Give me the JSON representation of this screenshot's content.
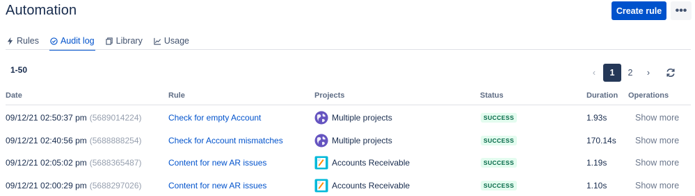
{
  "header": {
    "title": "Automation",
    "create_label": "Create rule",
    "more_label": "•••"
  },
  "tabs": [
    {
      "label": "Rules",
      "icon": "bolt-icon",
      "active": false
    },
    {
      "label": "Audit log",
      "icon": "check-circle-icon",
      "active": true
    },
    {
      "label": "Library",
      "icon": "copy-icon",
      "active": false
    },
    {
      "label": "Usage",
      "icon": "chart-line-icon",
      "active": false
    }
  ],
  "results": {
    "range": "1-50"
  },
  "pagination": {
    "prev": "‹",
    "pages": [
      "1",
      "2"
    ],
    "current": "1",
    "next": "›",
    "refresh_icon": "refresh-icon"
  },
  "table": {
    "columns": {
      "date": "Date",
      "rule": "Rule",
      "projects": "Projects",
      "status": "Status",
      "duration": "Duration",
      "operations": "Operations"
    },
    "rows": [
      {
        "date": "09/12/21 02:50:37 pm",
        "id": "(5689014224)",
        "rule": "Check for empty Account",
        "project": "Multiple projects",
        "project_icon": "globe-icon",
        "status": "SUCCESS",
        "duration": "1.93s",
        "ops": "Show more"
      },
      {
        "date": "09/12/21 02:40:56 pm",
        "id": "(5688888254)",
        "rule": "Check for Account mismatches",
        "project": "Multiple projects",
        "project_icon": "globe-icon",
        "status": "SUCCESS",
        "duration": "170.14s",
        "ops": "Show more"
      },
      {
        "date": "09/12/21 02:05:02 pm",
        "id": "(5688365487)",
        "rule": "Content for new AR issues",
        "project": "Accounts Receivable",
        "project_icon": "notebook-icon",
        "status": "SUCCESS",
        "duration": "1.19s",
        "ops": "Show more"
      },
      {
        "date": "09/12/21 02:00:29 pm",
        "id": "(5688297026)",
        "rule": "Content for new AR issues",
        "project": "Accounts Receivable",
        "project_icon": "notebook-icon",
        "status": "SUCCESS",
        "duration": "1.10s",
        "ops": "Show more"
      }
    ]
  },
  "colors": {
    "primary": "#0052cc",
    "success_bg": "#e3fcef",
    "success_text": "#006644",
    "active_page": "#253858"
  }
}
